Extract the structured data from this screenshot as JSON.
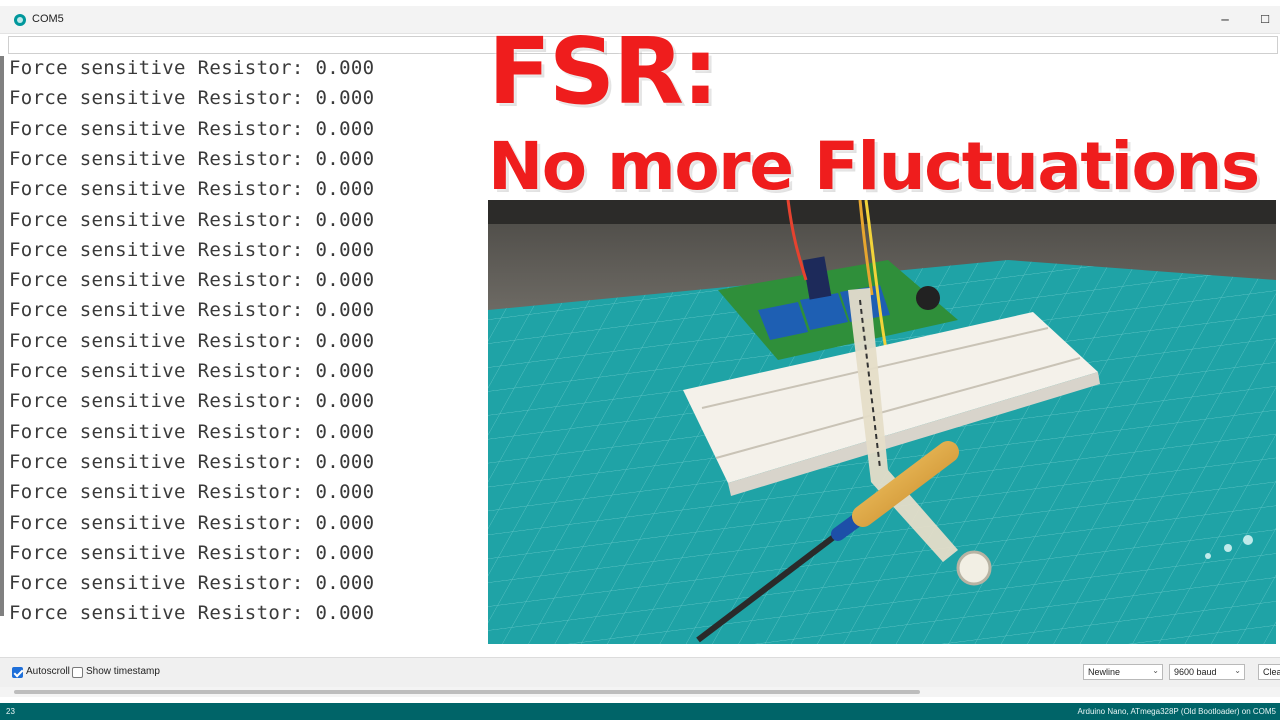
{
  "window": {
    "title": "COM5",
    "minimize_glyph": "─",
    "maximize_glyph": "☐"
  },
  "send_input": {
    "value": ""
  },
  "serial_lines": [
    "Force sensitive Resistor: 0.000",
    "Force sensitive Resistor: 0.000",
    "Force sensitive Resistor: 0.000",
    "Force sensitive Resistor: 0.000",
    "Force sensitive Resistor: 0.000",
    "Force sensitive Resistor: 0.000",
    "Force sensitive Resistor: 0.000",
    "Force sensitive Resistor: 0.000",
    "Force sensitive Resistor: 0.000",
    "Force sensitive Resistor: 0.000",
    "Force sensitive Resistor: 0.000",
    "Force sensitive Resistor: 0.000",
    "Force sensitive Resistor: 0.000",
    "Force sensitive Resistor: 0.000",
    "Force sensitive Resistor: 0.000",
    "Force sensitive Resistor: 0.000",
    "Force sensitive Resistor: 0.000",
    "Force sensitive Resistor: 0.000",
    "Force sensitive Resistor: 0.000"
  ],
  "overlay": {
    "line1": "FSR:",
    "line2": "No more Fluctuations",
    "color": "#ef1d1d"
  },
  "bottom_bar": {
    "autoscroll_label": "Autoscroll",
    "autoscroll_checked": true,
    "timestamp_label": "Show timestamp",
    "timestamp_checked": false,
    "line_ending": "Newline",
    "baud_rate": "9600 baud",
    "clear_label": "Clear output"
  },
  "status_bar": {
    "line_number": "23",
    "board": "Arduino Nano, ATmega328P (Old Bootloader) on COM5"
  },
  "colors": {
    "status_bar": "#006468",
    "accent": "#00979c",
    "mat": "#1fa3a6"
  }
}
